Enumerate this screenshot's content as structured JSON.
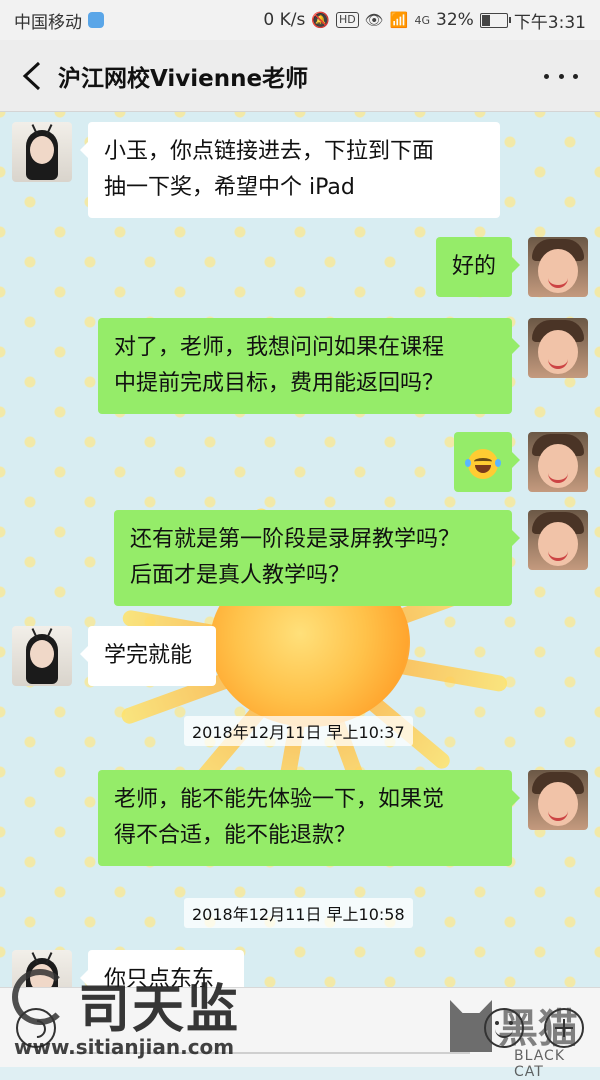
{
  "status_bar": {
    "carrier": "中国移动",
    "speed": "0 K/s",
    "hd": "HD",
    "network": "4G",
    "battery": "32%",
    "battery_level": 0.32,
    "time": "下午3:31"
  },
  "header": {
    "title": "沪江网校Vivienne老师"
  },
  "messages": [
    {
      "side": "left",
      "text_line1": "小玉，你点链接进去，下拉到下面",
      "text_line2": "抽一下奖，希望中个 iPad"
    },
    {
      "side": "right",
      "text": "好的"
    },
    {
      "side": "right",
      "text_line1": "对了，老师，我想问问如果在课程",
      "text_line2": "中提前完成目标，费用能返回吗？"
    },
    {
      "side": "right",
      "emoji": "face-with-tears-of-joy"
    },
    {
      "side": "right",
      "text_line1": "还有就是第一阶段是录屏教学吗？",
      "text_line2": "后面才是真人教学吗？"
    },
    {
      "side": "left",
      "text": "学完就能"
    },
    {
      "timestamp": "2018年12月11日 早上10:37"
    },
    {
      "side": "right",
      "text_line1": "老师，能不能先体验一下，如果觉",
      "text_line2": "得不合适，能不能退款？"
    },
    {
      "timestamp": "2018年12月11日 早上10:58"
    },
    {
      "side": "left",
      "text": "你只点东东"
    }
  ],
  "watermark": {
    "left_title": "司天监",
    "left_url": "www.sitianjian.com",
    "right_title": "黑猫",
    "right_sub": "BLACK CAT"
  }
}
